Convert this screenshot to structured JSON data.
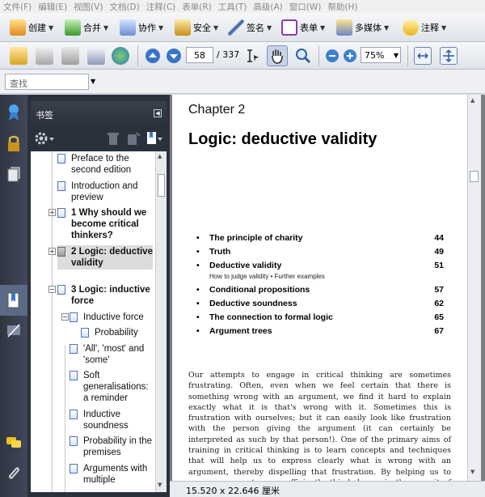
{
  "menu": [
    "文件(F)",
    "编辑(E)",
    "视图(V)",
    "文档(D)",
    "注释(C)",
    "表单(R)",
    "工具(T)",
    "高级(A)",
    "窗口(W)",
    "帮助(H)"
  ],
  "toolbar1": {
    "create": "创建",
    "combine": "合并",
    "collaborate": "协作",
    "secure": "安全",
    "sign": "签名",
    "forms": "表单",
    "multimedia": "多媒体",
    "comment": "注释"
  },
  "toolbar2": {
    "current_page": "58",
    "total_pages": "/ 337",
    "zoom": "75%"
  },
  "find": {
    "placeholder": "查找"
  },
  "bookmarks": {
    "title": "书签",
    "items": [
      "Preface to the second edition",
      "Introduction and preview",
      "1  Why should we become critical thinkers?",
      "2  Logic: deductive validity",
      "3  Logic: inductive force",
      "Inductive force",
      "Probability",
      "'All', 'most' and 'some'",
      "Soft generalisations: a reminder",
      "Inductive soundness",
      "Probability in the premises",
      "Arguments with multiple"
    ]
  },
  "document": {
    "chapter": "Chapter 2",
    "title": "Logic: deductive validity",
    "toc": [
      {
        "title": "The principle of charity",
        "page": "44"
      },
      {
        "title": "Truth",
        "page": "49"
      },
      {
        "title": "Deductive validity",
        "page": "51"
      },
      {
        "title": "Conditional propositions",
        "page": "57"
      },
      {
        "title": "Deductive soundness",
        "page": "62"
      },
      {
        "title": "The connection to formal logic",
        "page": "65"
      },
      {
        "title": "Argument trees",
        "page": "67"
      }
    ],
    "toc_sub": "How to judge validity • Further examples",
    "bullet": "•",
    "paragraph": "Our attempts to engage in critical thinking are sometimes frustrating. Often, even when we feel certain that there is something wrong with an argument, we find it hard to explain exactly what it is that's wrong with it. Sometimes this is frustration with ourselves; but it can easily look like frustration with the person giving the argument (it can certainly be interpreted as such by that person!). One of the primary aims of training in critical thinking is to learn concepts and techniques that will help us to express clearly what is wrong with an argument, thereby dispelling that frustration. By helping us to assess arguments more efficiently, this helps us in the pursuit of truth. But also, by becoming more articulate in our"
  },
  "status": {
    "page_size": "15.520 x 22.646 厘米"
  }
}
